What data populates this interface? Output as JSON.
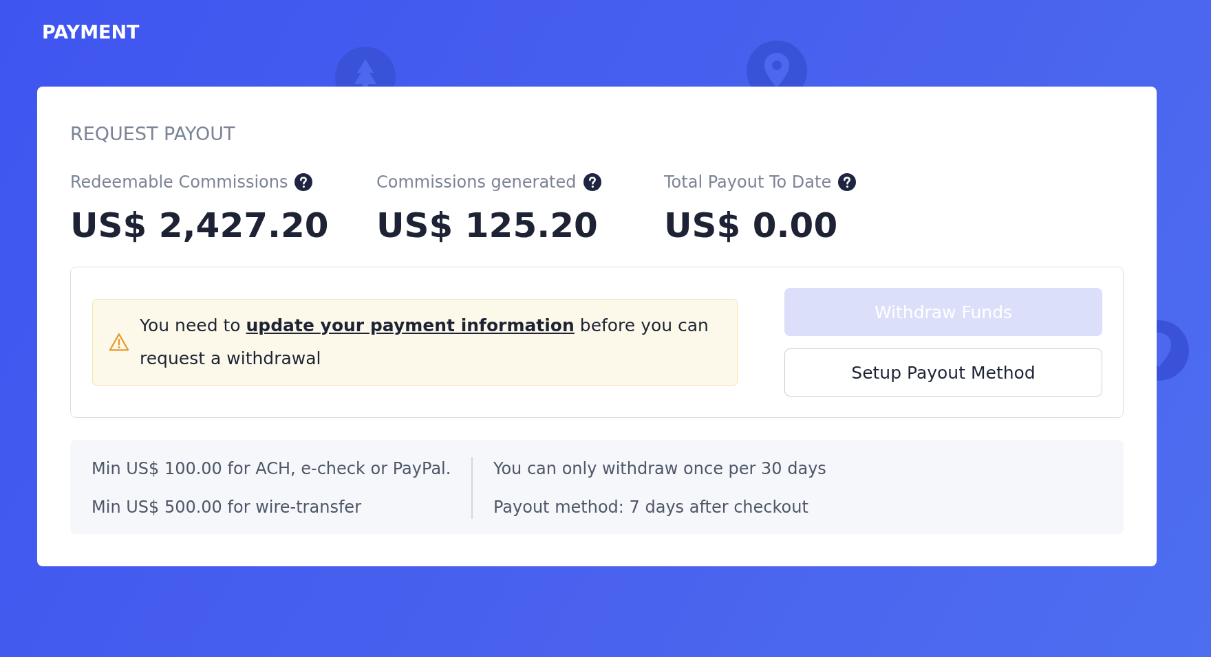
{
  "page": {
    "title": "PAYMENT"
  },
  "card": {
    "title": "REQUEST PAYOUT",
    "stats": [
      {
        "label": "Redeemable Commissions",
        "value": "US$ 2,427.20"
      },
      {
        "label": "Commissions generated",
        "value": "US$ 125.20"
      },
      {
        "label": "Total Payout To Date",
        "value": "US$ 0.00"
      }
    ],
    "warning": {
      "before": "You need to",
      "link": "update your payment information",
      "after": "before you can request a withdrawal"
    },
    "buttons": [
      {
        "label": "Withdraw Funds",
        "kind": "primary",
        "disabled": true
      },
      {
        "label": "Setup Payout Method",
        "kind": "outline",
        "disabled": false
      }
    ],
    "info": {
      "left": [
        "Min US$ 100.00 for ACH, e-check or PayPal.",
        "Min US$ 500.00 for wire-transfer"
      ],
      "right": [
        "You can only withdraw once per 30 days",
        "Payout method: 7 days after checkout"
      ]
    }
  }
}
